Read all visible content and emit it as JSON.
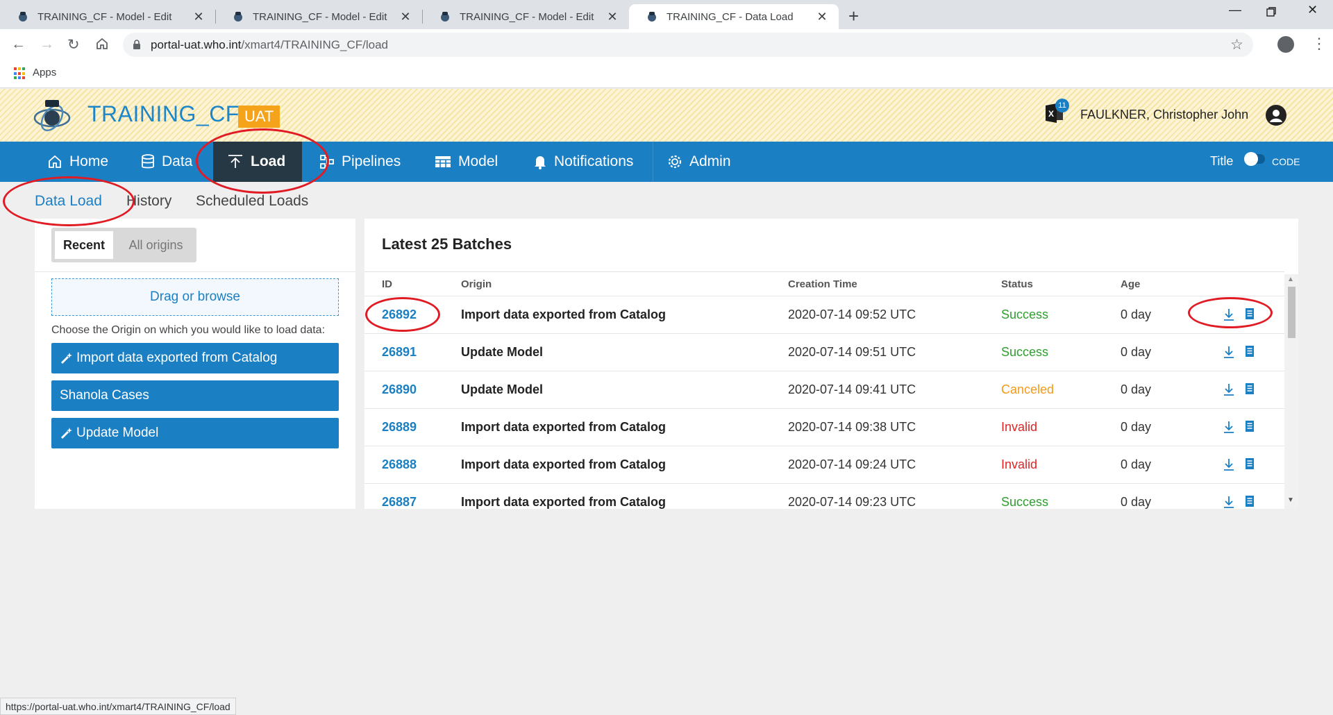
{
  "browser": {
    "tabs": [
      {
        "title": "TRAINING_CF - Model - Edit",
        "active": false
      },
      {
        "title": "TRAINING_CF - Model - Edit",
        "active": false
      },
      {
        "title": "TRAINING_CF - Model - Edit",
        "active": false
      },
      {
        "title": "TRAINING_CF - Data Load",
        "active": true
      }
    ],
    "url_host": "portal-uat.who.int",
    "url_path": "/xmart4/TRAINING_CF/load",
    "bookmarks": {
      "apps_label": "Apps"
    },
    "status_url": "https://portal-uat.who.int/xmart4/TRAINING_CF/load"
  },
  "app": {
    "title": "TRAINING_CF",
    "env_badge": "UAT",
    "notification_count": "11",
    "user_name": "FAULKNER, Christopher John",
    "brand_color": "#1b7fc4",
    "accent_color": "#f4a31b"
  },
  "nav": {
    "items": [
      {
        "label": "Home",
        "icon": "home-icon"
      },
      {
        "label": "Data",
        "icon": "database-icon"
      },
      {
        "label": "Load",
        "icon": "upload-icon",
        "active": true
      },
      {
        "label": "Pipelines",
        "icon": "pipelines-icon"
      },
      {
        "label": "Model",
        "icon": "model-icon"
      },
      {
        "label": "Notifications",
        "icon": "bell-icon"
      },
      {
        "label": "Admin",
        "icon": "gear-icon"
      }
    ],
    "toggle_left": "Title",
    "toggle_right": "CODE"
  },
  "subnav": {
    "items": [
      {
        "label": "Data Load",
        "active": true
      },
      {
        "label": "History"
      },
      {
        "label": "Scheduled Loads"
      }
    ]
  },
  "left_panel": {
    "seg_active": "Recent",
    "seg_inactive": "All origins",
    "drop_label": "Drag or browse",
    "hint": "Choose the Origin on which you would like to load data:",
    "origins": [
      {
        "label": "Import data exported from Catalog",
        "icon": "magic-wand-icon"
      },
      {
        "label": "Shanola Cases",
        "icon": ""
      },
      {
        "label": "Update Model",
        "icon": "magic-wand-icon"
      }
    ]
  },
  "batches": {
    "title": "Latest 25 Batches",
    "columns": [
      "ID",
      "Origin",
      "Creation Time",
      "Status",
      "Age"
    ],
    "rows": [
      {
        "id": "26892",
        "origin": "Import data exported from Catalog",
        "created": "2020-07-14 09:52 UTC",
        "status": "Success",
        "age": "0 day"
      },
      {
        "id": "26891",
        "origin": "Update Model",
        "created": "2020-07-14 09:51 UTC",
        "status": "Success",
        "age": "0 day"
      },
      {
        "id": "26890",
        "origin": "Update Model",
        "created": "2020-07-14 09:41 UTC",
        "status": "Canceled",
        "age": "0 day"
      },
      {
        "id": "26889",
        "origin": "Import data exported from Catalog",
        "created": "2020-07-14 09:38 UTC",
        "status": "Invalid",
        "age": "0 day"
      },
      {
        "id": "26888",
        "origin": "Import data exported from Catalog",
        "created": "2020-07-14 09:24 UTC",
        "status": "Invalid",
        "age": "0 day"
      },
      {
        "id": "26887",
        "origin": "Import data exported from Catalog",
        "created": "2020-07-14 09:23 UTC",
        "status": "Success",
        "age": "0 day"
      }
    ],
    "status_colors": {
      "Success": "#2e9e2e",
      "Canceled": "#f29a1a",
      "Invalid": "#e12424"
    }
  }
}
